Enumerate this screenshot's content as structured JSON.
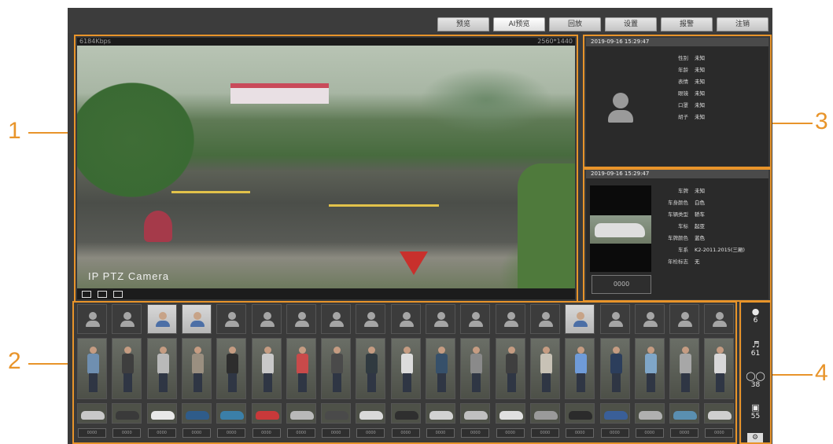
{
  "tabs": [
    "预览",
    "AI预览",
    "回放",
    "设置",
    "报警",
    "注销"
  ],
  "active_tab": 1,
  "callouts": [
    "1",
    "2",
    "3",
    "4"
  ],
  "video": {
    "bitrate": "6184Kbps",
    "resolution": "2560*1440",
    "camera_label": "IP PTZ Camera",
    "controls": [
      "fullscreen-icon",
      "layout-icon",
      "ptz-icon"
    ]
  },
  "face_panel": {
    "timestamp": "2019-09-16 15:29:47",
    "attributes": [
      {
        "k": "性别",
        "v": "未知"
      },
      {
        "k": "年龄",
        "v": "未知"
      },
      {
        "k": "表情",
        "v": "未知"
      },
      {
        "k": "眼镜",
        "v": "未知"
      },
      {
        "k": "口罩",
        "v": "未知"
      },
      {
        "k": "胡子",
        "v": "未知"
      }
    ]
  },
  "vehicle_panel": {
    "timestamp": "2019-09-16 15:29:47",
    "plate_button": "0000",
    "attributes": [
      {
        "k": "车牌",
        "v": "未知"
      },
      {
        "k": "车身颜色",
        "v": "白色"
      },
      {
        "k": "车辆类型",
        "v": "轿车"
      },
      {
        "k": "车标",
        "v": "起亚"
      },
      {
        "k": "车牌颜色",
        "v": "蓝色"
      },
      {
        "k": "车系",
        "v": "K2-2011.2015(三厢)"
      },
      {
        "k": "年检标志",
        "v": "无"
      }
    ]
  },
  "thumbnails": {
    "count": 19,
    "face_photo_columns": [
      2,
      3,
      14
    ],
    "plate_text": "0000",
    "person_colors": [
      "#6f8fb0",
      "#3e3e3e",
      "#b9b9b9",
      "#9a8f80",
      "#2d2d2d",
      "#c9c9c9",
      "#c84a4a",
      "#4a4a4a",
      "#303a40",
      "#dcdcdc",
      "#36506a",
      "#8a8a8a",
      "#3f3f3f",
      "#c8c2b6",
      "#6f9bd8",
      "#2c3e5c",
      "#7fa6c8",
      "#a7a7a7",
      "#d8d8d8"
    ],
    "car_colors": [
      "#c8c8c8",
      "#3a3a3a",
      "#e8e8e8",
      "#2f5c8a",
      "#3b7fa8",
      "#c8393a",
      "#b9b9b9",
      "#4a4a4a",
      "#d9d9d9",
      "#2f2f2f",
      "#d2d2d2",
      "#c0c0c0",
      "#e0e0e0",
      "#9a9a9a",
      "#2b2b2b",
      "#3a5f98",
      "#b0b0b0",
      "#5a8fb0",
      "#cfcfcf"
    ]
  },
  "stats": [
    {
      "icon": "person-icon",
      "value": "6"
    },
    {
      "icon": "pedestrian-icon",
      "value": "61"
    },
    {
      "icon": "bicycle-icon",
      "value": "38"
    },
    {
      "icon": "car-icon",
      "value": "55"
    }
  ]
}
